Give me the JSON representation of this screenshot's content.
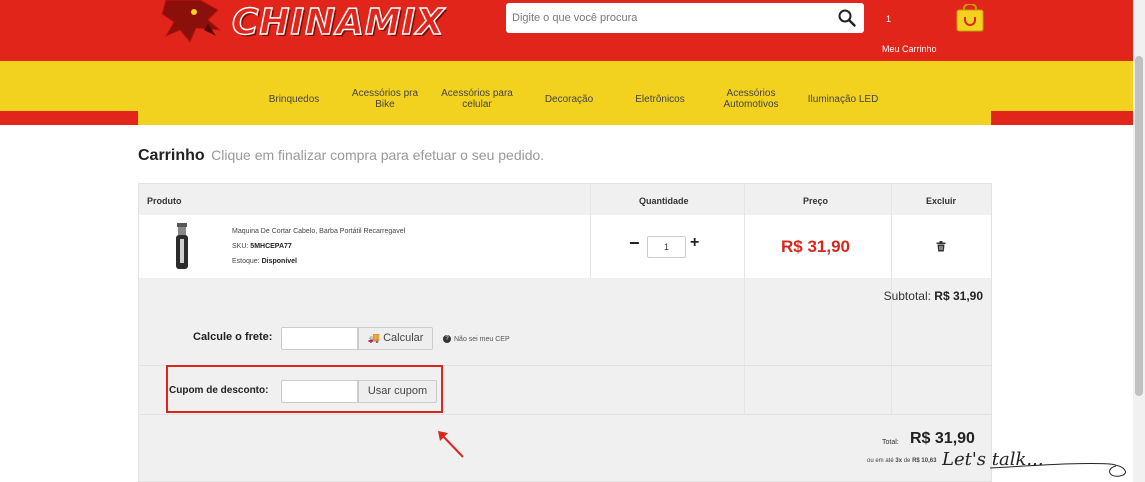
{
  "header": {
    "search_placeholder": "Digite o que você procura",
    "cart_count": "1",
    "cart_label": "Meu Carrinho",
    "logo_text": "CHINAMIX"
  },
  "nav": [
    {
      "label": "Brinquedos"
    },
    {
      "label": "Acessórios pra Bike"
    },
    {
      "label": "Acessórios para celular"
    },
    {
      "label": "Decoração"
    },
    {
      "label": "Eletrônicos"
    },
    {
      "label": "Acessórios Automotivos"
    },
    {
      "label": "Iluminação LED"
    }
  ],
  "page": {
    "title": "Carrinho",
    "subtitle": "Clique em finalizar compra para efetuar o seu pedido."
  },
  "table": {
    "headers": {
      "product": "Produto",
      "quantity": "Quantidade",
      "price": "Preço",
      "remove": "Excluir"
    }
  },
  "item": {
    "name": "Maquina De Cortar Cabelo, Barba Portátil Recarregavel",
    "sku_label": "SKU:",
    "sku": "5MHCEPA77",
    "stock_label": "Estoque:",
    "stock": "Disponível",
    "quantity": "1",
    "price": "R$ 31,90"
  },
  "summary": {
    "subtotal_label": "Subtotal:",
    "subtotal": "R$ 31,90",
    "shipping_label": "Calcule o frete:",
    "shipping_button": "Calcular",
    "cep_help": "Não sei meu CEP",
    "coupon_label": "Cupom de desconto:",
    "coupon_button": "Usar cupom",
    "total_label": "Total:",
    "total": "R$ 31,90",
    "install_prefix": "ou em até",
    "install_count": "3x",
    "install_mid": "de",
    "install_value": "R$ 10,63"
  },
  "watermark": "Let's talk..."
}
